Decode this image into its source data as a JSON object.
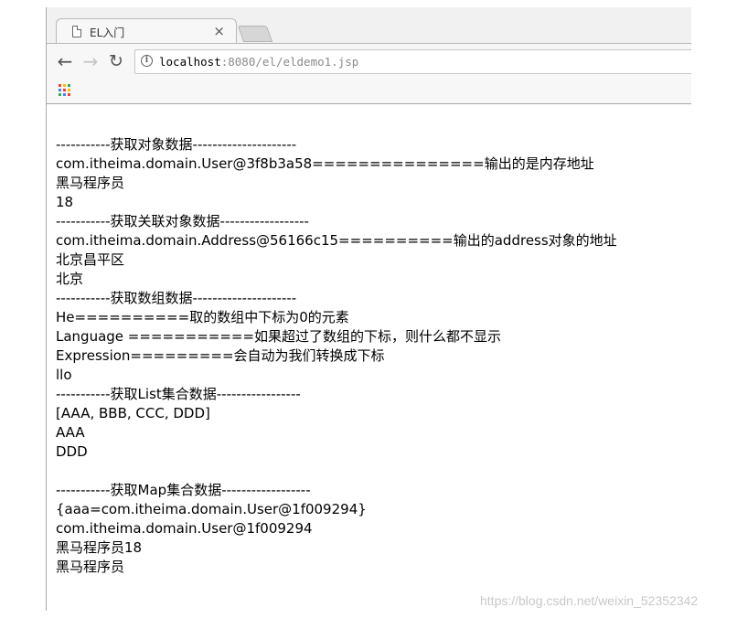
{
  "tab": {
    "title": "EL入门",
    "close": "×"
  },
  "toolbar": {
    "back": "←",
    "forward": "→",
    "reload": "↻",
    "info": "i",
    "url_host": "localhost",
    "url_rest": ":8080/el/eldemo1.jsp"
  },
  "page": {
    "lines": [
      "-----------获取对象数据---------------------",
      "com.itheima.domain.User@3f8b3a58===============输出的是内存地址",
      "黑马程序员",
      "18",
      "-----------获取关联对象数据------------------",
      "com.itheima.domain.Address@56166c15==========输出的address对象的地址",
      "北京昌平区",
      "北京",
      "-----------获取数组数据---------------------",
      "He==========取的数组中下标为0的元素",
      "Language ===========如果超过了数组的下标，则什么都不显示",
      "Expression=========会自动为我们转换成下标",
      "llo",
      "-----------获取List集合数据-----------------",
      "[AAA, BBB, CCC, DDD]",
      "AAA",
      "DDD",
      "",
      "-----------获取Map集合数据------------------",
      "{aaa=com.itheima.domain.User@1f009294}",
      "com.itheima.domain.User@1f009294",
      "黑马程序员18",
      "黑马程序员"
    ]
  },
  "watermark": "https://blog.csdn.net/weixin_52352342"
}
